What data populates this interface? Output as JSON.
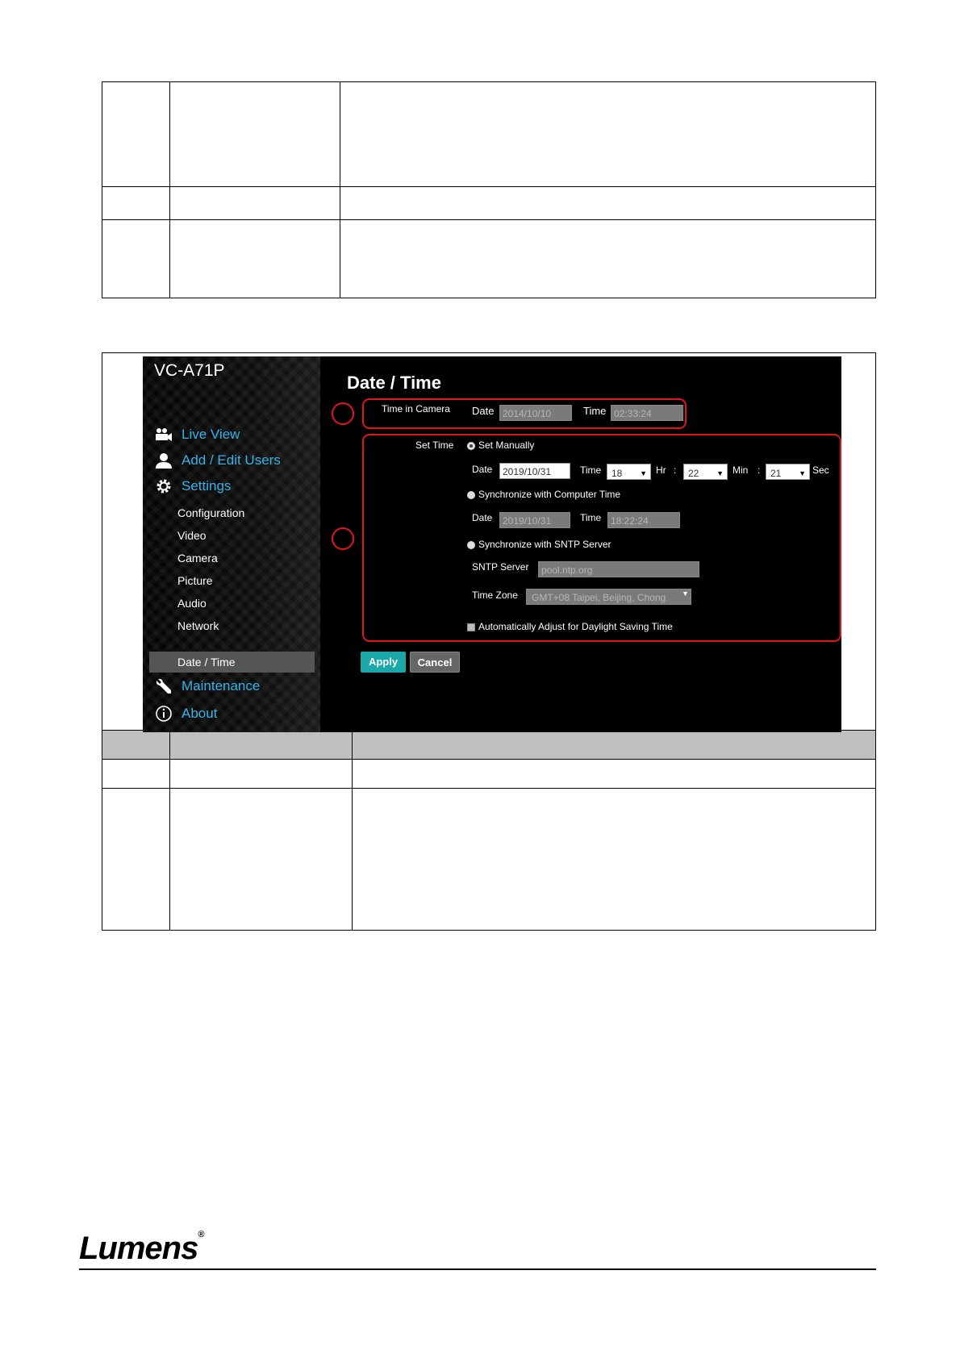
{
  "screenshot": {
    "model": "VC-A71P",
    "nav_main": [
      {
        "label": "Live View",
        "icon": "camera-users-icon"
      },
      {
        "label": "Add / Edit Users",
        "icon": "user-icon"
      },
      {
        "label": "Settings",
        "icon": "gear-icon"
      }
    ],
    "nav_sub": [
      "Configuration",
      "Video",
      "Camera",
      "Picture",
      "Audio",
      "Network",
      "Date / Time"
    ],
    "nav_bottom": [
      {
        "label": "Maintenance",
        "icon": "wrench-icon"
      },
      {
        "label": "About",
        "icon": "info-icon"
      }
    ],
    "active_item": "Date / Time",
    "page_title": "Date / Time",
    "time_in_camera": {
      "label": "Time in Camera",
      "date_label": "Date",
      "date_value": "2014/10/10",
      "time_label": "Time",
      "time_value": "02:33:24"
    },
    "set_time": {
      "label": "Set Time",
      "manual": {
        "label": "Set Manually",
        "date_label": "Date",
        "date_value": "2019/10/31",
        "time_label": "Time",
        "hour": "18",
        "hr_label": "Hr",
        "minute": "22",
        "min_label": "Min",
        "second": "21",
        "sec_label": "Sec",
        "colon": ":"
      },
      "computer": {
        "label": "Synchronize with Computer Time",
        "date_label": "Date",
        "date_value": "2019/10/31",
        "time_label": "Time",
        "time_value": "18:22:24"
      },
      "sntp": {
        "label": "Synchronize with SNTP Server",
        "server_label": "SNTP Server",
        "server_value": "pool.ntp.org",
        "zone_label": "Time Zone",
        "zone_value": "GMT+08 Taipei, Beijing, Chong"
      },
      "dst_label": "Automatically Adjust for Daylight Saving Time"
    },
    "apply_label": "Apply",
    "cancel_label": "Cancel",
    "colors": {
      "accent": "#36b3e8",
      "highlight": "#e0161c",
      "apply": "#1aa8a8"
    }
  },
  "footer": {
    "brand": "Lumens",
    "registered": "®"
  }
}
